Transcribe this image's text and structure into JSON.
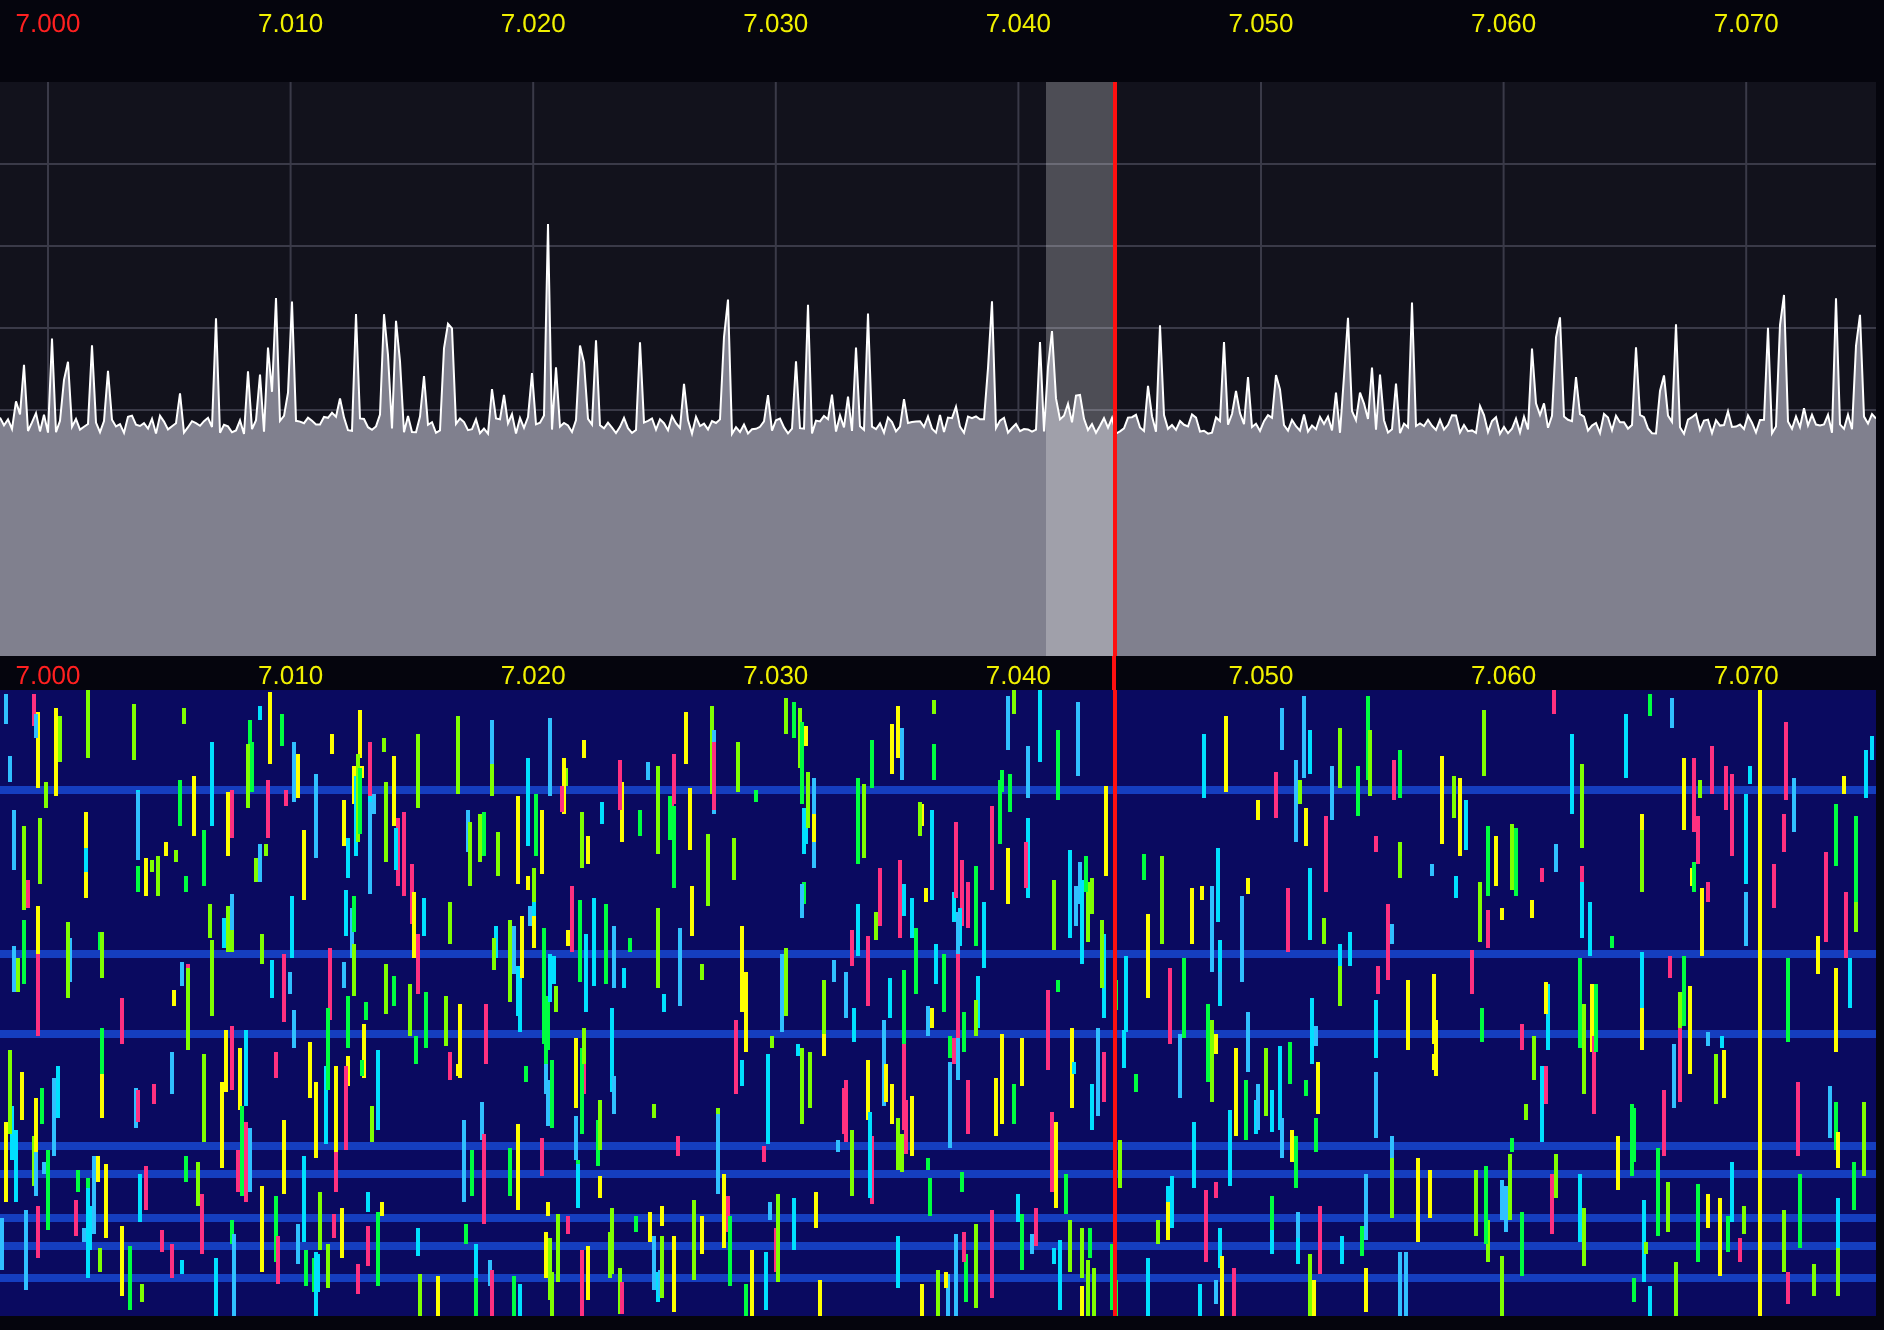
{
  "spectrum_scale": {
    "labels": [
      {
        "text": "7.000",
        "color": "#ff2020"
      },
      {
        "text": "7.010",
        "color": "#f0f000"
      },
      {
        "text": "7.020",
        "color": "#f0f000"
      },
      {
        "text": "7.030",
        "color": "#f0f000"
      },
      {
        "text": "7.040",
        "color": "#f0f000"
      },
      {
        "text": "7.050",
        "color": "#f0f000"
      },
      {
        "text": "7.060",
        "color": "#f0f000"
      },
      {
        "text": "7.070",
        "color": "#f0f000"
      }
    ]
  },
  "waterfall_scale": {
    "labels": [
      {
        "text": "7.000",
        "color": "#ff2020"
      },
      {
        "text": "7.010",
        "color": "#f0f000"
      },
      {
        "text": "7.020",
        "color": "#f0f000"
      },
      {
        "text": "7.030",
        "color": "#f0f000"
      },
      {
        "text": "7.040",
        "color": "#f0f000"
      },
      {
        "text": "7.050",
        "color": "#f0f000"
      },
      {
        "text": "7.060",
        "color": "#f0f000"
      },
      {
        "text": "7.070",
        "color": "#f0f000"
      }
    ]
  }
}
